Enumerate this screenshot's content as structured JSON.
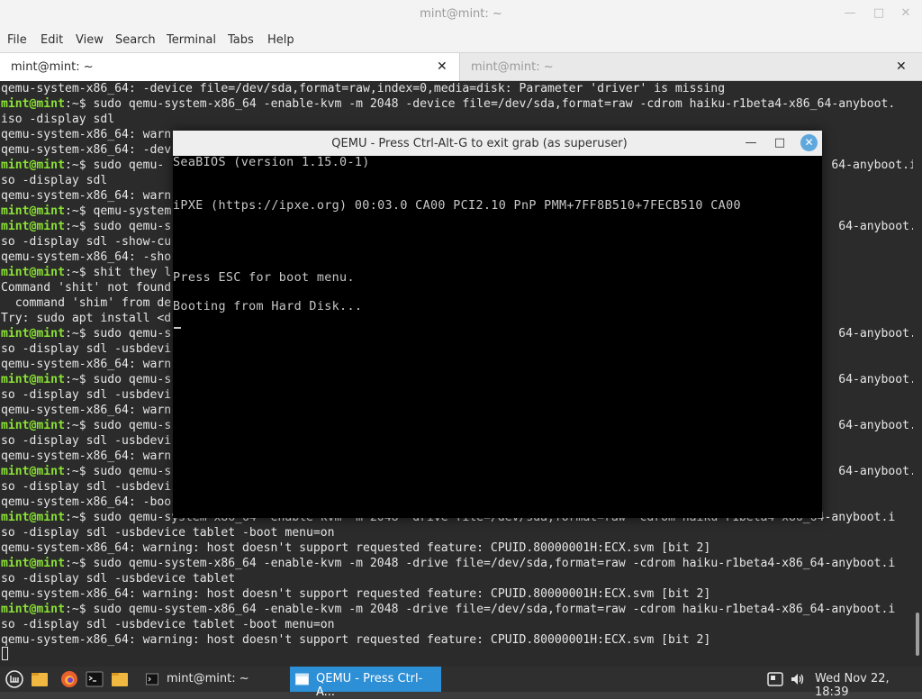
{
  "window": {
    "title": "mint@mint: ~"
  },
  "menu": [
    "File",
    "Edit",
    "View",
    "Search",
    "Terminal",
    "Tabs",
    "Help"
  ],
  "tabs": [
    {
      "label": "mint@mint: ~",
      "active": true
    },
    {
      "label": "mint@mint: ~",
      "active": false
    }
  ],
  "terminal": {
    "prompt": "mint@mint",
    "lines": [
      {
        "p": "",
        "t": "qemu-system-x86_64: -device file=/dev/sda,format=raw,index=0,media=disk: Parameter 'driver' is missing"
      },
      {
        "p": "mint@mint",
        "t": ":~$ sudo qemu-system-x86_64 -enable-kvm -m 2048 -device file=/dev/sda,format=raw -cdrom haiku-r1beta4-x86_64-anyboot."
      },
      {
        "p": "",
        "t": "iso -display sdl"
      },
      {
        "p": "",
        "t": "qemu-system-x86_64: warn"
      },
      {
        "p": "",
        "t": "qemu-system-x86_64: -dev"
      },
      {
        "p": "mint@mint",
        "t": ":~$ sudo qemu-                                                                                              64-anyboot.i"
      },
      {
        "p": "",
        "t": "so -display sdl"
      },
      {
        "p": "",
        "t": "qemu-system-x86_64: warn"
      },
      {
        "p": "mint@mint",
        "t": ":~$ qemu-system"
      },
      {
        "p": "mint@mint",
        "t": ":~$ sudo qemu-s                                                                                              64-anyboot.i"
      },
      {
        "p": "",
        "t": "so -display sdl -show-cu"
      },
      {
        "p": "",
        "t": "qemu-system-x86_64: -sho"
      },
      {
        "p": "mint@mint",
        "t": ":~$ shit they l"
      },
      {
        "p": "",
        "t": "Command 'shit' not found"
      },
      {
        "p": "",
        "t": "  command 'shim' from de"
      },
      {
        "p": "",
        "t": "Try: sudo apt install <d"
      },
      {
        "p": "mint@mint",
        "t": ":~$ sudo qemu-s                                                                                              64-anyboot.i"
      },
      {
        "p": "",
        "t": "so -display sdl -usbdevi"
      },
      {
        "p": "",
        "t": "qemu-system-x86_64: warn"
      },
      {
        "p": "mint@mint",
        "t": ":~$ sudo qemu-s                                                                                              64-anyboot.i"
      },
      {
        "p": "",
        "t": "so -display sdl -usbdevi"
      },
      {
        "p": "",
        "t": "qemu-system-x86_64: warn"
      },
      {
        "p": "mint@mint",
        "t": ":~$ sudo qemu-s                                                                                              64-anyboot.i"
      },
      {
        "p": "",
        "t": "so -display sdl -usbdevi"
      },
      {
        "p": "",
        "t": "qemu-system-x86_64: warn"
      },
      {
        "p": "mint@mint",
        "t": ":~$ sudo qemu-s                                                                                              64-anyboot.i"
      },
      {
        "p": "",
        "t": "so -display sdl -usbdevi"
      },
      {
        "p": "",
        "t": "qemu-system-x86_64: -boo"
      },
      {
        "p": "mint@mint",
        "t": ":~$ sudo qemu-system-x86_64 -enable-kvm -m 2048 -drive file=/dev/sda,format=raw -cdrom haiku-r1beta4-x86_64-anyboot.i"
      },
      {
        "p": "",
        "t": "so -display sdl -usbdevice tablet -boot menu=on"
      },
      {
        "p": "",
        "t": "qemu-system-x86_64: warning: host doesn't support requested feature: CPUID.80000001H:ECX.svm [bit 2]"
      },
      {
        "p": "mint@mint",
        "t": ":~$ sudo qemu-system-x86_64 -enable-kvm -m 2048 -drive file=/dev/sda,format=raw -cdrom haiku-r1beta4-x86_64-anyboot.i"
      },
      {
        "p": "",
        "t": "so -display sdl -usbdevice tablet"
      },
      {
        "p": "",
        "t": "qemu-system-x86_64: warning: host doesn't support requested feature: CPUID.80000001H:ECX.svm [bit 2]"
      },
      {
        "p": "mint@mint",
        "t": ":~$ sudo qemu-system-x86_64 -enable-kvm -m 2048 -drive file=/dev/sda,format=raw -cdrom haiku-r1beta4-x86_64-anyboot.i"
      },
      {
        "p": "",
        "t": "so -display sdl -usbdevice tablet -boot menu=on"
      },
      {
        "p": "",
        "t": "qemu-system-x86_64: warning: host doesn't support requested feature: CPUID.80000001H:ECX.svm [bit 2]"
      }
    ]
  },
  "qemu": {
    "title": "QEMU - Press Ctrl-Alt-G to exit grab (as superuser)",
    "screen_lines": [
      "SeaBIOS (version 1.15.0-1)",
      "iPXE (https://ipxe.org) 00:03.0 CA00 PCI2.10 PnP PMM+7FF8B510+7FECB510 CA00",
      "Press ESC for boot menu.",
      "Booting from Hard Disk..."
    ]
  },
  "taskbar": {
    "tasks": [
      {
        "label": "mint@mint: ~"
      },
      {
        "label": "QEMU - Press Ctrl-A..."
      }
    ],
    "clock": "Wed Nov 22, 18:39"
  },
  "colors": {
    "prompt_green": "#8ae234",
    "terminal_bg": "#2b2b2b",
    "taskbar_active": "#2d8fd5",
    "folder_yellow": "#f0b840"
  }
}
